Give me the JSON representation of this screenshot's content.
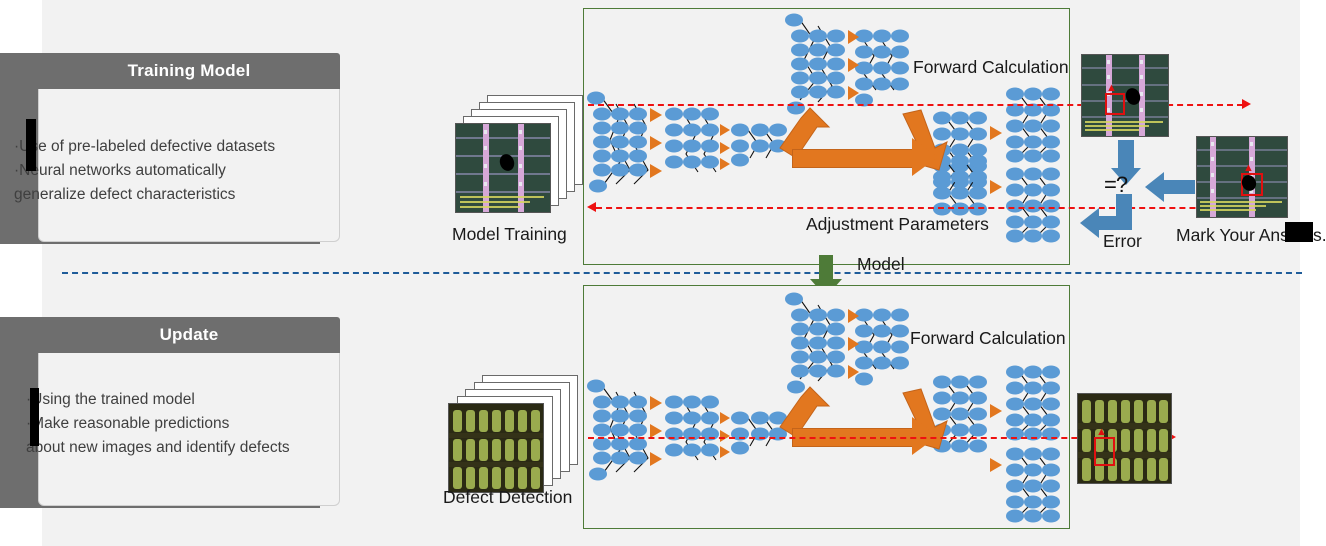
{
  "panels": [
    {
      "title": "Training Model",
      "bullets": [
        "·Use of pre-labeled defective datasets",
        "·Neural networks automatically",
        "  generalize defect characteristics"
      ]
    },
    {
      "title": "Update",
      "bullets": [
        "·Using the trained model",
        "·Make reasonable predictions",
        " about new images and identify defects"
      ]
    }
  ],
  "top_box": {
    "forward_label": "Forward Calculation",
    "adjust_label": "Adjustment Parameters",
    "input_label": "Model Training"
  },
  "bottom_box": {
    "forward_label": "Forward Calculation",
    "input_label": "Defect Detection"
  },
  "model_arrow_label": "Model",
  "compare": {
    "equals_label": "=?",
    "error_label": "Error",
    "answer_label": "Mark Your Answ",
    "answer_suffix": "s."
  },
  "colors": {
    "page_bg": "#f2f2f2",
    "panel_header": "#6e6e6e",
    "panel_body": "#f2f2f2",
    "box_border": "#4e7b38",
    "flow_red": "#ee1111",
    "arrow_orange": "#e2771f",
    "arrow_blue": "#4a86b8",
    "divider_blue": "#1f5c99",
    "node_blue": "#5b9bd5",
    "wafer_green": "#2f4a3e",
    "pcb_olive": "#2b2a14"
  }
}
